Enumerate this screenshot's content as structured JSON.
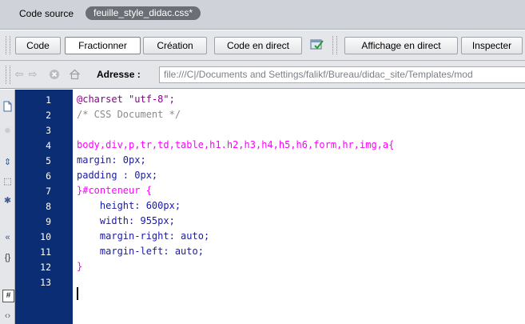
{
  "document_bar": {
    "source_label": "Code source",
    "file_tab": "feuille_style_didac.css*"
  },
  "toolbar": {
    "buttons": [
      "Code",
      "Fractionner",
      "Création",
      "Code en direct",
      "Affichage en direct",
      "Inspecter"
    ]
  },
  "address_bar": {
    "label": "Adresse :",
    "value": "file:///C|/Documents and Settings/falikf/Bureau/didac_site/Templates/mod"
  },
  "editor": {
    "line_numbers": [
      "1",
      "2",
      "3",
      "4",
      "5",
      "6",
      "7",
      "8",
      "9",
      "10",
      "11",
      "12",
      "13"
    ],
    "lines": [
      "@charset \"utf-8\";",
      "/* CSS Document */",
      "",
      "body,div,p,tr,td,table,h1.h2,h3,h4,h5,h6,form,hr,img,a{",
      "margin: 0px;",
      "padding : 0px;",
      "}#conteneur {",
      "    height: 600px;",
      "    width: 955px;",
      "    margin-right: auto;",
      "    margin-left: auto;",
      "}",
      ""
    ],
    "colors": {
      "charset": "#8b008b",
      "comment": "#8a8a8a",
      "selector": "#ff00ff",
      "property": "#1a1aa6",
      "value": "#b300b3",
      "gutter_bg": "#0b2d73"
    }
  },
  "side_icons": [
    "document-icon",
    "sun-icon",
    "collapse-icon",
    "expand-icon",
    "select-icon",
    "arrow-icon",
    "braces-icon",
    "hash-icon",
    "chevrons-icon"
  ]
}
